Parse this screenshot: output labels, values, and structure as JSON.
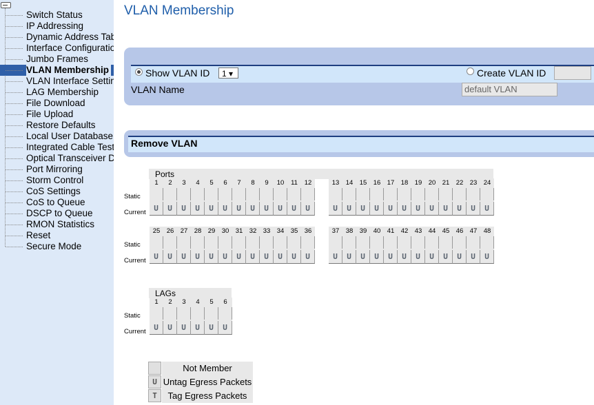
{
  "sidebar": {
    "items": [
      {
        "label": "Switch Status"
      },
      {
        "label": "IP Addressing"
      },
      {
        "label": "Dynamic Address Table"
      },
      {
        "label": "Interface Configuration"
      },
      {
        "label": "Jumbo Frames"
      },
      {
        "label": "VLAN Membership",
        "active": true
      },
      {
        "label": "VLAN Interface Settings"
      },
      {
        "label": "LAG Membership"
      },
      {
        "label": "File Download"
      },
      {
        "label": "File Upload"
      },
      {
        "label": "Restore Defaults"
      },
      {
        "label": "Local User Database"
      },
      {
        "label": "Integrated Cable Test"
      },
      {
        "label": "Optical Transceiver Diagnostics"
      },
      {
        "label": "Port Mirroring"
      },
      {
        "label": "Storm Control"
      },
      {
        "label": "CoS Settings"
      },
      {
        "label": "CoS to Queue"
      },
      {
        "label": "DSCP to Queue"
      },
      {
        "label": "RMON Statistics"
      },
      {
        "label": "Reset"
      },
      {
        "label": "Secure Mode"
      }
    ]
  },
  "page": {
    "title": "VLAN Membership"
  },
  "vlan_form": {
    "show_vlan_label": "Show VLAN ID",
    "show_vlan_selected": true,
    "vlan_id_value": "1 ▾",
    "create_vlan_label": "Create VLAN ID",
    "create_vlan_value": "",
    "vlan_name_label": "VLAN Name",
    "vlan_name_value": "default VLAN"
  },
  "remove_vlan": {
    "label": "Remove VLAN"
  },
  "ports": {
    "title": "Ports",
    "static_label": "Static",
    "current_label": "Current",
    "current_value": "U",
    "row1_numbers": [
      "1",
      "2",
      "3",
      "4",
      "5",
      "6",
      "7",
      "8",
      "9",
      "10",
      "11",
      "12",
      "13",
      "14",
      "15",
      "16",
      "17",
      "18",
      "19",
      "20",
      "21",
      "22",
      "23",
      "24"
    ],
    "row2_numbers": [
      "25",
      "26",
      "27",
      "28",
      "29",
      "30",
      "31",
      "32",
      "33",
      "34",
      "35",
      "36",
      "37",
      "38",
      "39",
      "40",
      "41",
      "42",
      "43",
      "44",
      "45",
      "46",
      "47",
      "48"
    ]
  },
  "lags": {
    "title": "LAGs",
    "static_label": "Static",
    "current_label": "Current",
    "current_value": "U",
    "numbers": [
      "1",
      "2",
      "3",
      "4",
      "5",
      "6"
    ]
  },
  "legend": {
    "items": [
      {
        "icon": "",
        "label": "Not Member"
      },
      {
        "icon": "U",
        "label": "Untag Egress Packets"
      },
      {
        "icon": "T",
        "label": "Tag Egress Packets"
      }
    ]
  },
  "colors": {
    "title_blue": "#1f5eaa",
    "panel": "#b7c7e8",
    "panel_band": "#d1e6fa",
    "sidebar_bg": "#dde9f8",
    "active_highlight": "#2f5fa8"
  }
}
